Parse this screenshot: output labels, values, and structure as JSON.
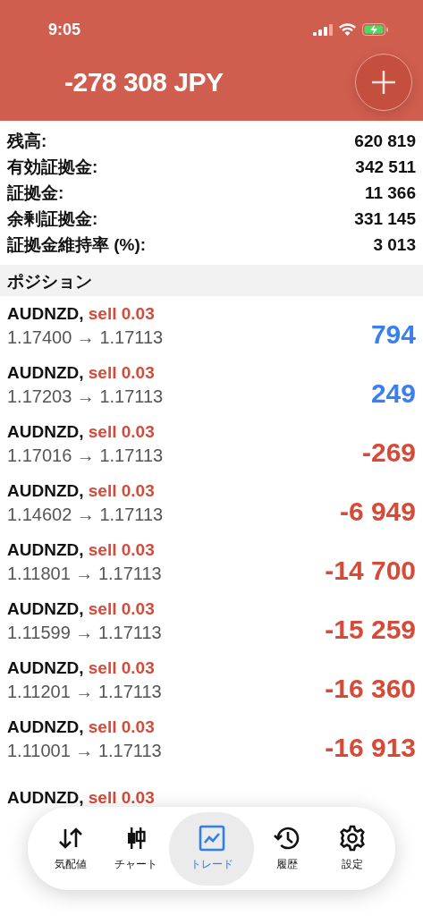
{
  "status_bar": {
    "time": "9:05"
  },
  "header": {
    "profit": "-278 308 JPY"
  },
  "summary": [
    {
      "label": "残高:",
      "value": "620 819"
    },
    {
      "label": "有効証拠金:",
      "value": "342 511"
    },
    {
      "label": "証拠金:",
      "value": "11 366"
    },
    {
      "label": "余剰証拠金:",
      "value": "331 145"
    },
    {
      "label": "証拠金維持率 (%):",
      "value": "3 013"
    }
  ],
  "section_title": "ポジション",
  "positions": [
    {
      "symbol": "AUDNZD,",
      "side": "sell 0.03",
      "prices": "1.17400 → 1.17113",
      "profit": "794",
      "color": "#3a7ff0"
    },
    {
      "symbol": "AUDNZD,",
      "side": "sell 0.03",
      "prices": "1.17203 → 1.17113",
      "profit": "249",
      "color": "#3a7ff0"
    },
    {
      "symbol": "AUDNZD,",
      "side": "sell 0.03",
      "prices": "1.17016 → 1.17113",
      "profit": "-269",
      "color": "#d64a38"
    },
    {
      "symbol": "AUDNZD,",
      "side": "sell 0.03",
      "prices": "1.14602 → 1.17113",
      "profit": "-6 949",
      "color": "#d64a38"
    },
    {
      "symbol": "AUDNZD,",
      "side": "sell 0.03",
      "prices": "1.11801 → 1.17113",
      "profit": "-14 700",
      "color": "#d64a38"
    },
    {
      "symbol": "AUDNZD,",
      "side": "sell 0.03",
      "prices": "1.11599 → 1.17113",
      "profit": "-15 259",
      "color": "#d64a38"
    },
    {
      "symbol": "AUDNZD,",
      "side": "sell 0.03",
      "prices": "1.11201 → 1.17113",
      "profit": "-16 360",
      "color": "#d64a38"
    },
    {
      "symbol": "AUDNZD,",
      "side": "sell 0.03",
      "prices": "1.11001 → 1.17113",
      "profit": "-16 913",
      "color": "#d64a38"
    },
    {
      "symbol": "AUDNZD,",
      "side": "sell 0.03"
    }
  ],
  "tabs": [
    {
      "label": "気配値",
      "kind": "quotes",
      "selected": false
    },
    {
      "label": "チャート",
      "kind": "chart",
      "selected": false
    },
    {
      "label": "トレード",
      "kind": "trade",
      "selected": true
    },
    {
      "label": "履歴",
      "kind": "history",
      "selected": false
    },
    {
      "label": "設定",
      "kind": "settings",
      "selected": false
    }
  ]
}
